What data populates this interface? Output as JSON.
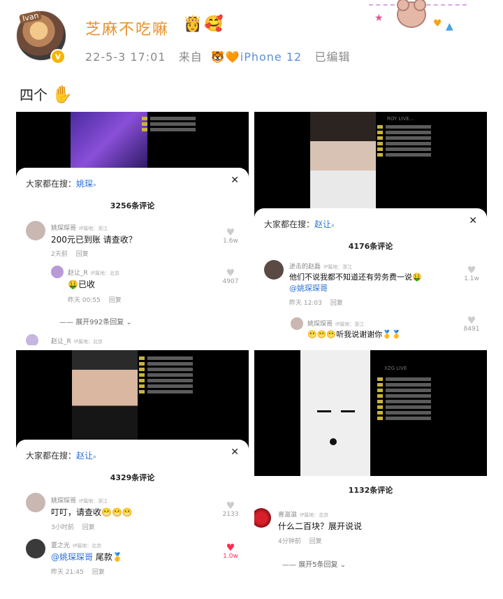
{
  "header": {
    "avatar_tag": "Ivan",
    "vip_badge": "v",
    "username": "芝麻不吃嘛",
    "name_emojis": [
      "👸",
      "🥰"
    ],
    "timestamp": "22-5-3 17:01",
    "from_label": "来自",
    "device_emojis": "🐯🧡",
    "device": "iPhone 12",
    "edited": "已编辑"
  },
  "post": {
    "text": "四个",
    "emoji": "✋"
  },
  "screenshots": [
    {
      "search_label": "大家都在搜：",
      "search_keyword": "姚琛",
      "comment_count": "3256条评论",
      "comments": [
        {
          "name": "姚琛琛哥",
          "ip": "IP属地：浙江",
          "text": "200元已到账 请查收？",
          "time": "2天前",
          "reply": "回复",
          "likes": "1.6w"
        },
        {
          "name": "赵让_R",
          "ip": "IP属地：北京",
          "text": "🤑已收",
          "time": "昨天 00:55",
          "reply": "回复",
          "likes": "4907"
        }
      ],
      "expand": "展开992条回复",
      "partial_name": "赵让_R",
      "partial_ip": "IP属地：北京"
    },
    {
      "live_title": "ROY LIVE...",
      "search_label": "大家都在搜：",
      "search_keyword": "赵让",
      "comment_count": "4176条评论",
      "comments": [
        {
          "name": "进击的赵磊",
          "ip": "IP属地：浙江",
          "text": "他们不说我都不知道还有劳务费一说🤑",
          "at": "@姚琛琛哥",
          "time": "昨天 12:03",
          "reply": "回复",
          "likes": "1.1w"
        },
        {
          "name": "姚琛琛哥",
          "ip": "IP属地：浙江",
          "text": "😬😬😬听我说谢谢你🥇🥇",
          "likes": "8491"
        }
      ]
    },
    {
      "search_label": "大家都在搜：",
      "search_keyword": "赵让",
      "comment_count": "4329条评论",
      "comments": [
        {
          "name": "姚琛琛哥",
          "ip": "IP属地：浙江",
          "text": "叮叮，请查收😬😬😬",
          "time": "3小时前",
          "reply": "回复",
          "likes": "2133"
        },
        {
          "name": "夏之光",
          "ip": "IP属地：北京",
          "at": "@姚琛琛哥",
          "text": " 尾款🥇",
          "time": "昨天 21:45",
          "reply": "回复",
          "likes": "1.0w"
        }
      ]
    },
    {
      "live_title": "XZG LIVE",
      "comment_count": "1132条评论",
      "comments": [
        {
          "name": "喜滋滋",
          "ip": "IP属地：北京",
          "text": "什么二百块？展开说说",
          "time": "4分钟前",
          "reply": "回复"
        }
      ],
      "expand": "展开5条回复"
    }
  ]
}
